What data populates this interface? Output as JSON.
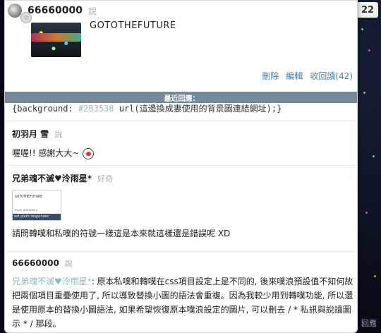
{
  "page": {
    "badge_count": "22",
    "corner_link": "回應"
  },
  "plurk": {
    "owner": "66660000",
    "verb": "說",
    "content": "GOTOTHEFUTURE",
    "actions": {
      "delete": "刪除",
      "edit": "編輯",
      "read": "收回讀(42)"
    }
  },
  "recent_bar": {
    "label": "最近回應："
  },
  "code_line": {
    "prefix": "{background: ",
    "color_value": "#2B3538",
    "suffix": " url(這邊換成妻使用的背景圖連結網址);}"
  },
  "responses": [
    {
      "name": "初羽月 雪",
      "verb": "說",
      "text": "喔喔!! 感謝大大~",
      "emoticon": "heart-emoticon"
    },
    {
      "name": "兄弟魂不滅♥泠雨星*",
      "verb": "好奇",
      "image": {
        "title": "GOTOTHEFUTURE",
        "subtitle": "mute promote o",
        "strip": "ost plurk responses"
      },
      "text": "請問轉噗和私噗的符號一樣這是本來就這樣還是錯誤呢 XD"
    },
    {
      "name": "66660000",
      "verb": "說",
      "quote": "兄弟魂不滅♥泠雨星*",
      "text": ": 原本私噗和轉噗在css項目設定上是不同的, 後來噗浪預設值不知何故把兩個項目重疊使用了, 所以導致替換小圖的語法會重複。因為我較少用到轉噗功能, 所以還是使用原本的替換小圖語法, 如果希望恢復原本噗浪設定的圖片, 可以刪去 / * 私訊與說讀圖示 * / 那段。"
    }
  ],
  "colors": {
    "bar_bg": "#74889a",
    "link": "#4a7fa6",
    "quote": "#8bc"
  }
}
